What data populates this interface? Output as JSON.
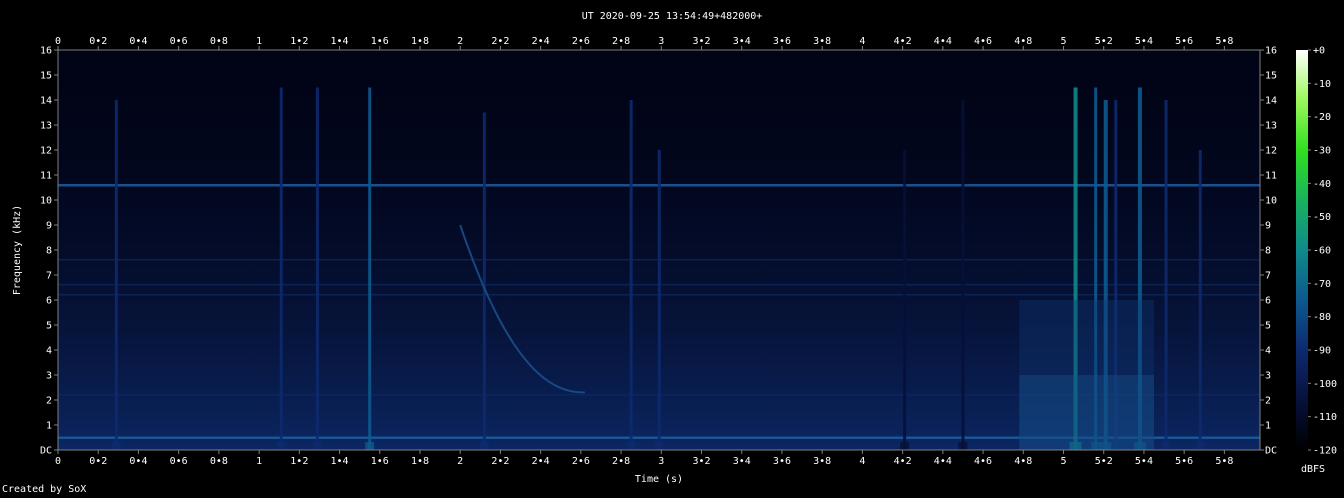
{
  "chart_data": {
    "type": "heatmap",
    "title": "UT 2020-09-25 13:54:49+482000+",
    "xlabel": "Time (s)",
    "ylabel": "Frequency (kHz)",
    "xlim": [
      0,
      5.96
    ],
    "ylim": [
      0,
      16
    ],
    "x_ticks": [
      "0",
      "0•2",
      "0•4",
      "0•6",
      "0•8",
      "1",
      "1•2",
      "1•4",
      "1•6",
      "1•8",
      "2",
      "2•2",
      "2•4",
      "2•6",
      "2•8",
      "3",
      "3•2",
      "3•4",
      "3•6",
      "3•8",
      "4",
      "4•2",
      "4•4",
      "4•6",
      "4•8",
      "5",
      "5•2",
      "5•4",
      "5•6",
      "5•8"
    ],
    "y_ticks": [
      "DC",
      "1",
      "2",
      "3",
      "4",
      "5",
      "6",
      "7",
      "8",
      "9",
      "10",
      "11",
      "12",
      "13",
      "14",
      "15",
      "16"
    ],
    "colorbar": {
      "label": "dBFS",
      "range": [
        -120,
        0
      ],
      "ticks": [
        "+0",
        "-10",
        "-20",
        "-30",
        "-40",
        "-50",
        "-60",
        "-70",
        "-80",
        "-90",
        "-100",
        "-110",
        "-120"
      ],
      "colors": [
        "#000000",
        "#07103a",
        "#0d2a6e",
        "#0d5a8e",
        "#0f8a8a",
        "#18b060",
        "#30e020",
        "#a0f860",
        "#ffffff"
      ]
    },
    "background_color": "#010416",
    "horizontal_lines_khz": [
      10.6,
      6.2,
      6.6,
      7.6,
      2.2,
      0.5
    ],
    "vertical_streaks": [
      {
        "t": 0.29,
        "fmax": 14.0,
        "level": -90
      },
      {
        "t": 1.11,
        "fmax": 14.5,
        "level": -88
      },
      {
        "t": 1.29,
        "fmax": 14.5,
        "level": -95
      },
      {
        "t": 1.55,
        "fmax": 14.5,
        "level": -82
      },
      {
        "t": 2.12,
        "fmax": 13.5,
        "level": -90
      },
      {
        "t": 2.85,
        "fmax": 14.0,
        "level": -88
      },
      {
        "t": 2.99,
        "fmax": 12.0,
        "level": -96
      },
      {
        "t": 4.5,
        "fmax": 14.0,
        "level": -98
      },
      {
        "t": 4.21,
        "fmax": 12.0,
        "level": -100
      },
      {
        "t": 5.06,
        "fmax": 14.5,
        "level": -65
      },
      {
        "t": 5.16,
        "fmax": 14.5,
        "level": -80
      },
      {
        "t": 5.21,
        "fmax": 14.0,
        "level": -78
      },
      {
        "t": 5.26,
        "fmax": 14.0,
        "level": -85
      },
      {
        "t": 5.38,
        "fmax": 14.5,
        "level": -75
      },
      {
        "t": 5.51,
        "fmax": 14.0,
        "level": -90
      },
      {
        "t": 5.68,
        "fmax": 12.0,
        "level": -96
      }
    ],
    "chirp": {
      "t_start": 2.0,
      "t_end": 2.62,
      "f_start_khz": 9.0,
      "f_end_khz": 2.3
    },
    "grid": false
  },
  "footer": {
    "credit": "Created by SoX"
  }
}
